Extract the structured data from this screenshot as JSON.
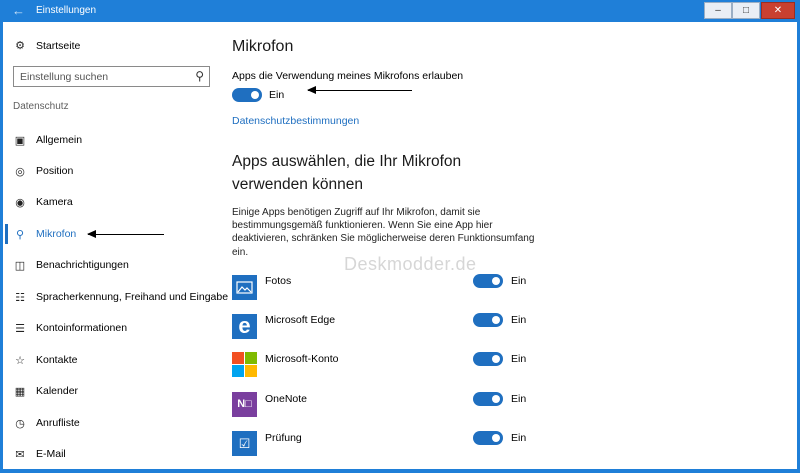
{
  "window": {
    "title": "Einstellungen",
    "back_icon": "back-arrow-icon",
    "minimize_icon": "minimize-icon",
    "maximize_icon": "maximize-icon",
    "close_icon": "close-icon",
    "accent_color": "#1f7fd8"
  },
  "sidebar": {
    "home_label": "Startseite",
    "search_placeholder": "Einstellung suchen",
    "group_label": "Datenschutz",
    "selected_color": "#1f6fc0",
    "items": [
      {
        "label": "Allgemein",
        "icon": "lock-icon"
      },
      {
        "label": "Position",
        "icon": "location-icon"
      },
      {
        "label": "Kamera",
        "icon": "camera-icon"
      },
      {
        "label": "Mikrofon",
        "icon": "microphone-icon",
        "selected": true
      },
      {
        "label": "Benachrichtigungen",
        "icon": "notification-icon"
      },
      {
        "label": "Spracherkennung, Freihand und Eingabe",
        "icon": "speech-icon"
      },
      {
        "label": "Kontoinformationen",
        "icon": "account-info-icon"
      },
      {
        "label": "Kontakte",
        "icon": "contacts-icon"
      },
      {
        "label": "Kalender",
        "icon": "calendar-icon"
      },
      {
        "label": "Anrufliste",
        "icon": "call-history-icon"
      },
      {
        "label": "E-Mail",
        "icon": "mail-icon"
      }
    ]
  },
  "main": {
    "title": "Mikrofon",
    "allow_label": "Apps die Verwendung meines Mikrofons erlauben",
    "allow_state": "Ein",
    "privacy_link": "Datenschutzbestimmungen",
    "apps_heading": "Apps auswählen, die Ihr Mikrofon verwenden können",
    "description": "Einige Apps benötigen Zugriff auf Ihr Mikrofon, damit sie bestimmungsgemäß funktionieren. Wenn Sie eine App hier deaktivieren, schränken Sie möglicherweise deren Funktionsumfang ein.",
    "watermark": "Deskmodder.de",
    "apps": [
      {
        "name": "Fotos",
        "state": "Ein",
        "icon": "photos-app-icon"
      },
      {
        "name": "Microsoft Edge",
        "state": "Ein",
        "icon": "edge-app-icon"
      },
      {
        "name": "Microsoft-Konto",
        "state": "Ein",
        "icon": "microsoft-account-app-icon"
      },
      {
        "name": "OneNote",
        "state": "Ein",
        "icon": "onenote-app-icon"
      },
      {
        "name": "Prüfung",
        "state": "Ein",
        "icon": "exam-app-icon"
      }
    ]
  }
}
